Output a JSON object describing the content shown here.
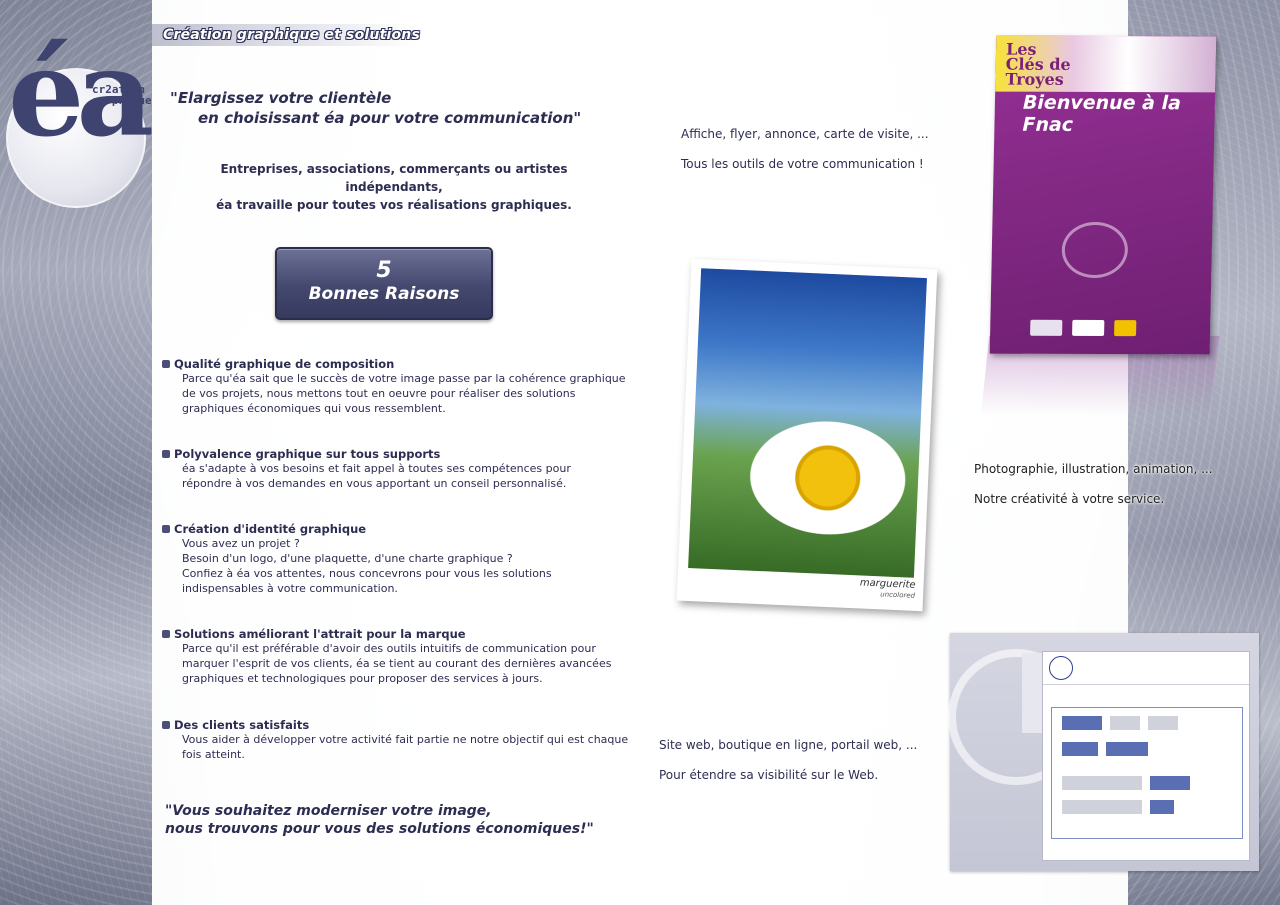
{
  "header": {
    "title": "Création graphique et solutions"
  },
  "logo": {
    "mark": "éa",
    "tagline_line1": "cr2ation",
    "tagline_line2": "gr?phique"
  },
  "quote_top": {
    "line1": "\"Elargissez votre clientèle",
    "line2": "en choisissant éa pour votre communication\""
  },
  "intro": {
    "line1": "Entreprises, associations, commerçants ou artistes indépendants,",
    "line2": "éa travaille pour toutes vos réalisations graphiques."
  },
  "reasons_box": {
    "number": "5",
    "label": "Bonnes Raisons"
  },
  "reasons": [
    {
      "title": "Qualité graphique de composition",
      "lines": [
        "Parce qu'éa sait que le succès de votre image passe par la cohérence graphique",
        "de vos projets, nous mettons tout en oeuvre pour réaliser des solutions",
        "graphiques économiques qui vous ressemblent."
      ]
    },
    {
      "title": "Polyvalence graphique sur tous supports",
      "lines": [
        "éa s'adapte à vos besoins et fait appel à toutes ses compétences pour",
        "répondre à vos demandes en vous apportant un conseil personnalisé."
      ]
    },
    {
      "title": "Création d'identité graphique",
      "lines": [
        "Vous avez un projet ?",
        "Besoin d'un logo, d'une plaquette, d'une charte graphique ?",
        "Confiez à éa vos attentes, nous concevrons pour vous les solutions",
        "indispensables à votre communication."
      ]
    },
    {
      "title": "Solutions améliorant l'attrait pour la marque",
      "lines": [
        "Parce qu'il est préférable d'avoir des outils intuitifs de communication pour",
        "marquer l'esprit de vos clients, éa se tient au courant des dernières avancées",
        "graphiques et technologiques pour proposer des services à jours."
      ]
    },
    {
      "title": "Des clients satisfaits",
      "lines": [
        "Vous aider à développer votre activité fait partie ne notre objectif qui est chaque",
        "fois atteint."
      ]
    }
  ],
  "quote_bottom": {
    "line1": "\"Vous souhaitez moderniser votre image,",
    "line2": "nous trouvons pour vous des solutions économiques!\""
  },
  "captions": {
    "print": {
      "line1": "Affiche, flyer, annonce, carte de visite, ...",
      "line2": "Tous les outils de votre communication !"
    },
    "photo": {
      "line1": "Photographie, illustration, animation, ...",
      "line2": "Notre créativité à votre service."
    },
    "web": {
      "line1": "Site web, boutique en ligne, portail web, ...",
      "line2": "Pour étendre sa visibilité sur le Web."
    }
  },
  "flyer": {
    "brand_line1": "Les",
    "brand_line2": "Clés de",
    "brand_line3": "Troyes",
    "headline": "Bienvenue à la Fnac"
  },
  "photo": {
    "label": "marguerite",
    "sublabel": "uncolored"
  }
}
